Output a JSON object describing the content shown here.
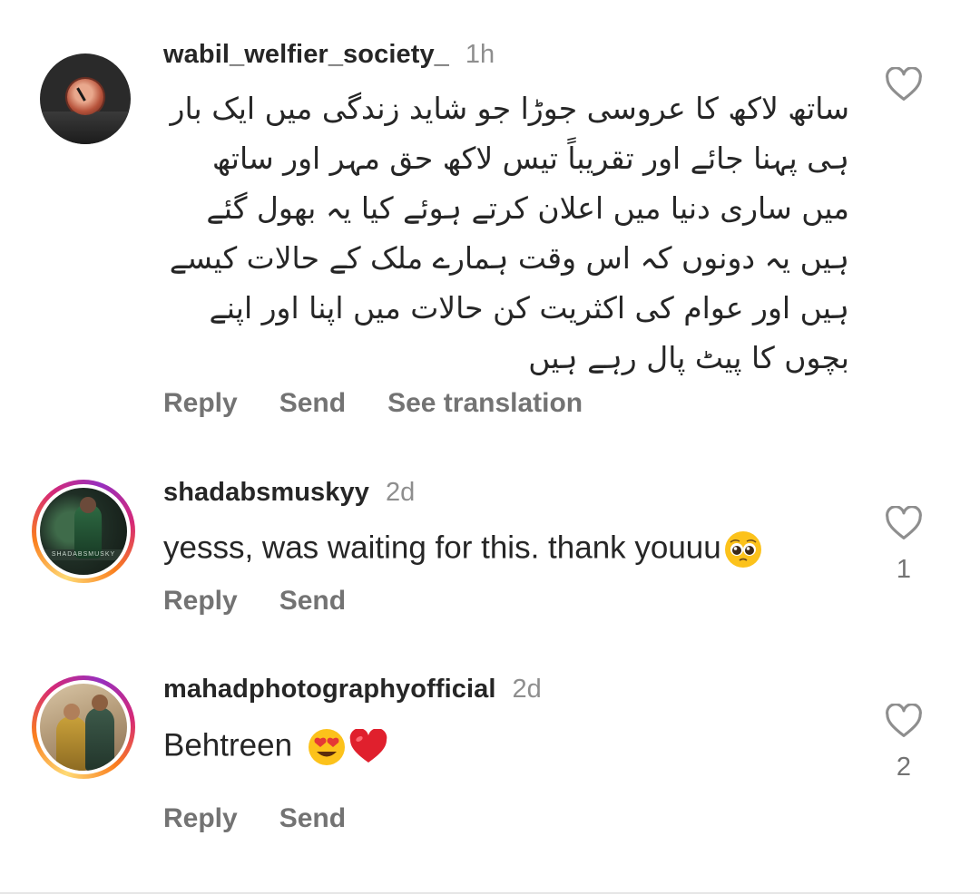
{
  "comments": [
    {
      "username": "wabil_welfier_society_",
      "time": "1h",
      "text": "ساتھ لاکھ کا عروسی جوڑا جو شاید زندگی میں ایک بار ہی پہنا جائے اور  تقریباً تیس لاکھ حق مہر اور ساتھ میں ساری دنیا میں اعلان کرتے ہوئے کیا یہ بھول گئے ہیں یہ دونوں کہ اس وقت ہمارے ملک کے حالات کیسے ہیں اور عوام کی اکثریت کن حالات میں اپنا اور اپنے بچوں کا پیٹ پال رہے ہیں",
      "actions": [
        "Reply",
        "Send",
        "See translation"
      ],
      "likes": ""
    },
    {
      "username": "shadabsmuskyy",
      "time": "2d",
      "text": "yesss, was waiting for this. thank youuu",
      "emoji": "pleading-face",
      "avatar_caption": "SHADABSMUSKY",
      "actions": [
        "Reply",
        "Send"
      ],
      "likes": "1"
    },
    {
      "username": "mahadphotographyofficial",
      "time": "2d",
      "text": "Behtreen",
      "emoji": [
        "heart-eyes-face",
        "red-heart"
      ],
      "actions": [
        "Reply",
        "Send"
      ],
      "likes": "2"
    }
  ],
  "icons": {
    "like": "heart-outline-icon"
  },
  "colors": {
    "text": "#262626",
    "secondary": "#8e8e8e",
    "action": "#737373",
    "story_ring": [
      "#feda75",
      "#fa7e1e",
      "#d62976",
      "#962fbf"
    ]
  }
}
